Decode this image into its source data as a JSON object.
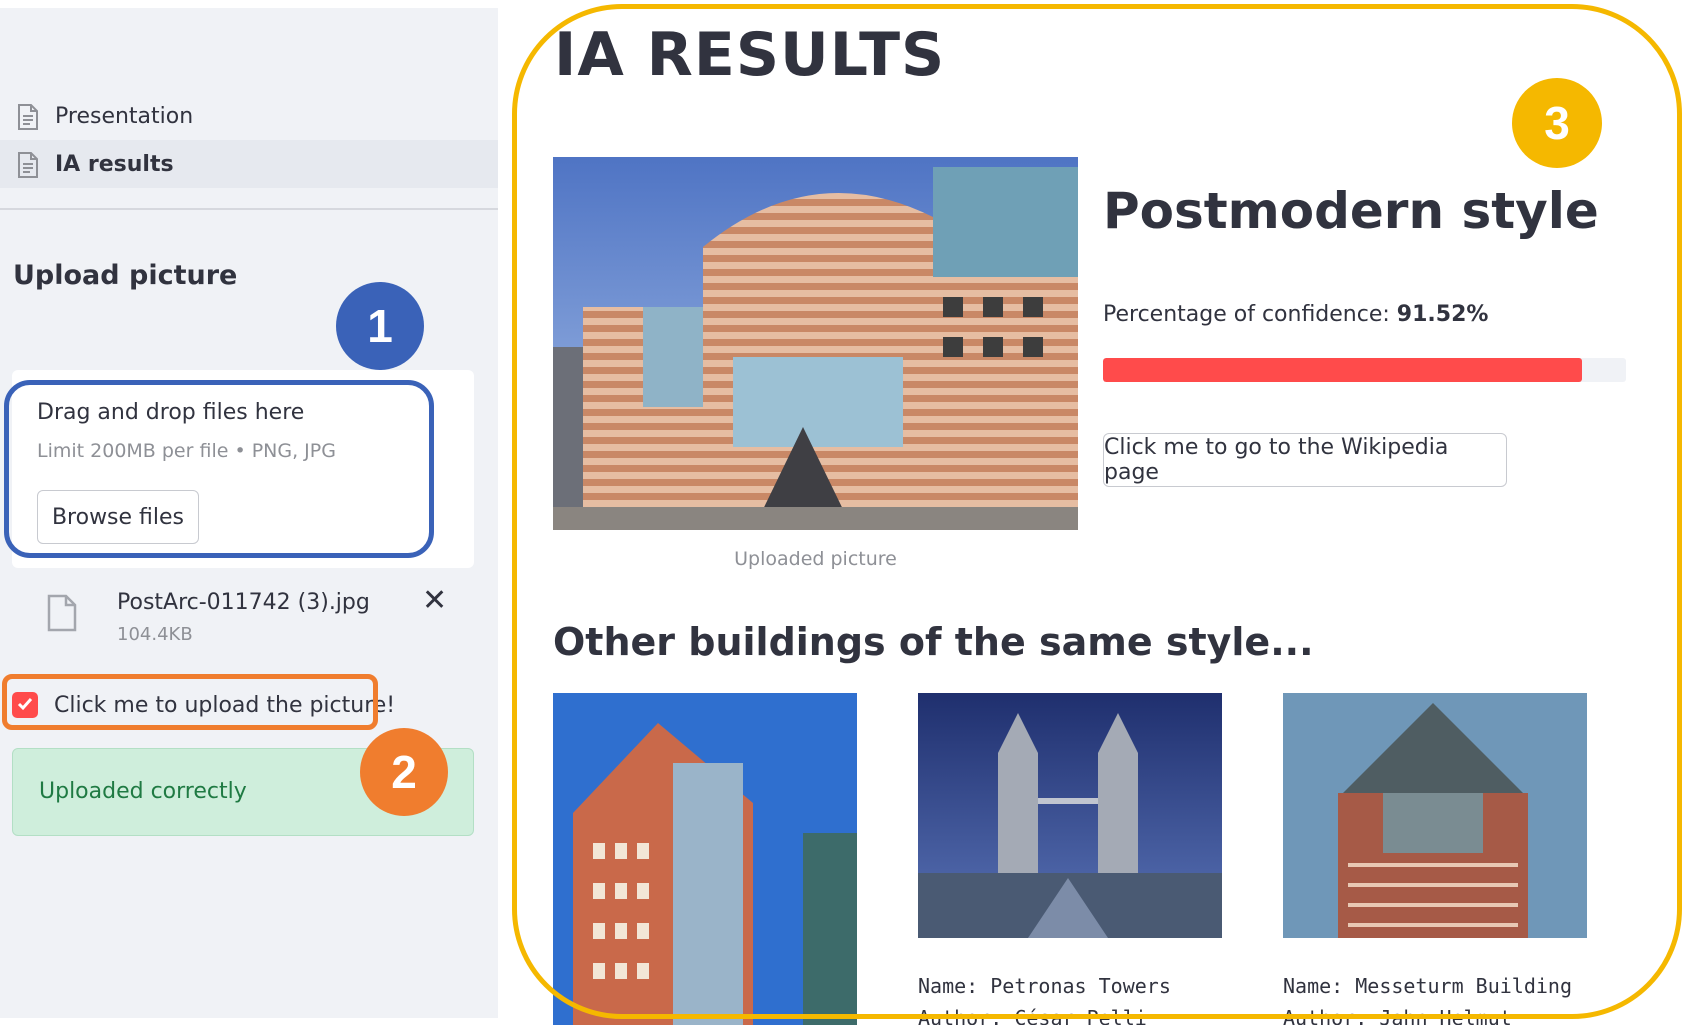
{
  "sidebar": {
    "nav": [
      {
        "label": "Presentation",
        "icon": "document-icon",
        "active": false
      },
      {
        "label": "IA results",
        "icon": "document-icon",
        "active": true
      }
    ],
    "upload_heading": "Upload picture",
    "dropzone": {
      "title": "Drag and drop files here",
      "subtitle": "Limit 200MB per file • PNG, JPG",
      "browse_label": "Browse files"
    },
    "file": {
      "name": "PostArc-011742 (3).jpg",
      "size": "104.4KB",
      "close_glyph": "✕"
    },
    "checkbox": {
      "label": "Click me to upload the picture!",
      "checked": true
    },
    "success_message": "Uploaded correctly"
  },
  "main": {
    "title": "IA RESULTS",
    "image_caption": "Uploaded picture",
    "style_name": "Postmodern style",
    "confidence_label": "Percentage of confidence: ",
    "confidence_value": "91.52%",
    "confidence_fraction": 0.9152,
    "wiki_button": "Click me to go to the Wikipedia page",
    "other_heading": "Other buildings of the same style...",
    "others": [
      {
        "name_line": "",
        "author_line": ""
      },
      {
        "name_line": "Name: Petronas Towers",
        "author_line": "Author: César Pelli"
      },
      {
        "name_line": "Name: Messeturm Building",
        "author_line": "Author: Jahn Helmut"
      }
    ]
  },
  "annotations": [
    {
      "number": "1",
      "color": "#3a62b8"
    },
    {
      "number": "2",
      "color": "#f07d2e"
    },
    {
      "number": "3",
      "color": "#f5b800"
    }
  ],
  "colors": {
    "primary": "#ff4b4b",
    "sidebar_bg": "#f0f2f6",
    "success_bg": "#cfeedc",
    "success_text": "#1f7a43",
    "annotation_blue": "#3a62b8",
    "annotation_orange": "#f07d2e",
    "annotation_yellow": "#f5b800"
  }
}
